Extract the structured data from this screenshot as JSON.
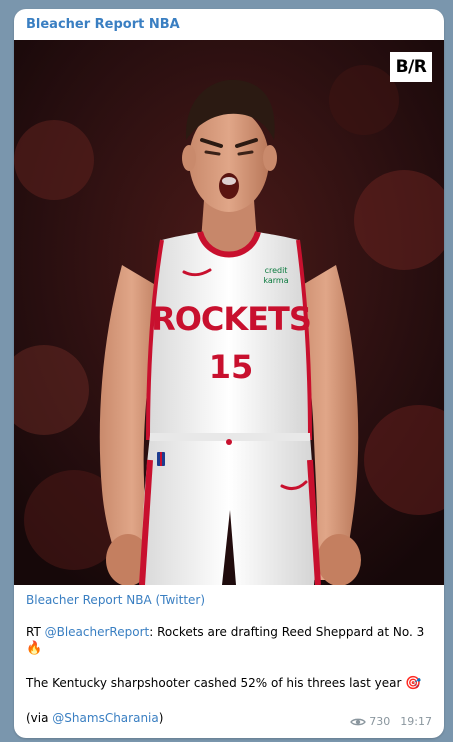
{
  "channel": {
    "name": "Bleacher Report NBA"
  },
  "media": {
    "logo_text": "B/R",
    "jersey_team": "ROCKETS",
    "jersey_number": "15",
    "sponsor_line1": "credit",
    "sponsor_line2": "karma"
  },
  "message": {
    "source": "Bleacher Report NBA (Twitter)",
    "rt_prefix": "RT ",
    "rt_handle": "@BleacherReport",
    "rt_text": ": Rockets are drafting Reed Sheppard at No. 3",
    "fire_emoji": "🔥",
    "line2": "The Kentucky sharpshooter cashed 52% of his threes last year ",
    "target_emoji": "🎯",
    "via_prefix": "(via ",
    "via_handle": "@ShamsCharania",
    "via_suffix": ")"
  },
  "meta": {
    "icon": "eye-icon",
    "views": "730",
    "time": "19:17"
  },
  "colors": {
    "background": "#7a96ad",
    "link": "#3a7fc2",
    "jersey_red": "#c8102e"
  }
}
